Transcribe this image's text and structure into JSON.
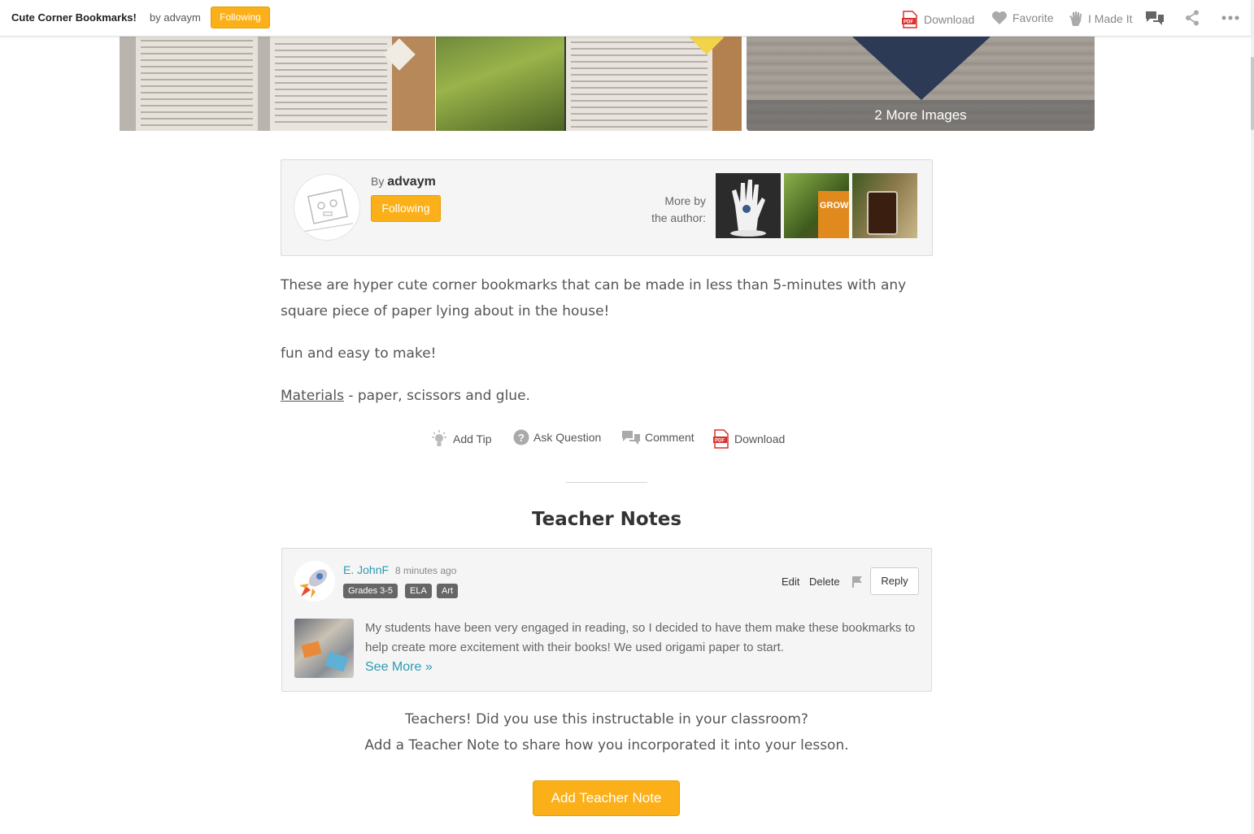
{
  "header": {
    "title": "Cute Corner Bookmarks!",
    "by_text": "by advaym",
    "follow_label": "Following",
    "actions": {
      "download": "Download",
      "favorite": "Favorite",
      "made_it": "I Made It"
    },
    "icons": [
      "pdf-icon",
      "heart-icon",
      "hand-icon",
      "comments-icon",
      "share-icon",
      "more-icon"
    ]
  },
  "gallery": {
    "more_images_label": "2 More Images"
  },
  "author": {
    "by_prefix": "By",
    "name": "advaym",
    "follow_label": "Following",
    "more_by_line1": "More by",
    "more_by_line2": "the author:"
  },
  "body": {
    "paragraph1": "These are hyper cute corner bookmarks that can be made in less than 5-minutes with any square piece of paper lying about in the house!",
    "paragraph2": "fun and easy to make!",
    "materials_link": "Materials",
    "materials_rest": " - paper, scissors and glue."
  },
  "actions": {
    "add_tip": "Add Tip",
    "ask_question": "Ask Question",
    "comment": "Comment",
    "download": "Download"
  },
  "teacher_notes": {
    "heading": "Teacher Notes",
    "note": {
      "author": "E. JohnF",
      "time": "8 minutes ago",
      "tags": [
        "Grades 3-5",
        "ELA",
        "Art"
      ],
      "edit": "Edit",
      "delete": "Delete",
      "reply": "Reply",
      "text": "My students have been very engaged in reading, so I decided to have them make these bookmarks to help create more excitement with their books! We used origami paper to start.",
      "see_more": "See More »"
    },
    "cta_line1": "Teachers! Did you use this instructable in your classroom?",
    "cta_line2": "Add a Teacher Note to share how you incorporated it into your lesson.",
    "add_button": "Add Teacher Note"
  },
  "colors": {
    "accent": "#fbb019",
    "link": "#2a9bb3",
    "pdf_red": "#d9302c"
  }
}
